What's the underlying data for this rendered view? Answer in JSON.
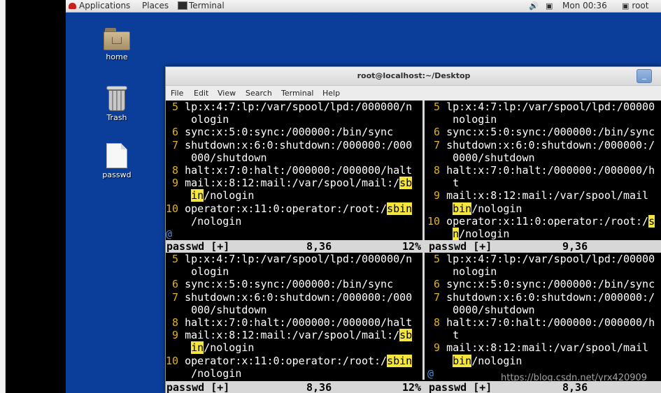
{
  "top_panel": {
    "applications_label": "Applications",
    "places_label": "Places",
    "task_label": "Terminal",
    "clock": "Mon 00:36",
    "user": "root"
  },
  "desktop_icons": [
    {
      "label": "home",
      "icon": "folder-icon"
    },
    {
      "label": "Trash",
      "icon": "trash-icon"
    },
    {
      "label": "passwd",
      "icon": "file-icon"
    }
  ],
  "window": {
    "title": "root@localhost:~/Desktop",
    "minimize_label": "_",
    "menu": [
      "File",
      "Edit",
      "View",
      "Search",
      "Terminal",
      "Help"
    ]
  },
  "panes": {
    "top_left": {
      "lines": [
        {
          "n": " 5",
          "segs": [
            {
              "t": " lp:x:4:7:lp:/var/spool/lpd:/000000/n"
            }
          ]
        },
        {
          "n": "",
          "segs": [
            {
              "t": "    ologin"
            }
          ]
        },
        {
          "n": " 6",
          "segs": [
            {
              "t": " sync:x:5:0:sync:/000000:/bin/sync"
            }
          ]
        },
        {
          "n": " 7",
          "segs": [
            {
              "t": " shutdown:x:6:0:shutdown:/000000:/000"
            }
          ]
        },
        {
          "n": "",
          "segs": [
            {
              "t": "    000/shutdown"
            }
          ]
        },
        {
          "n": " 8",
          "segs": [
            {
              "t": " halt:x:7:0:halt:/000000:/000000/halt"
            }
          ]
        },
        {
          "n": " 9",
          "segs": [
            {
              "t": " mail:x:8:12:mail:/var/spool/mail:/"
            },
            {
              "t": "sb",
              "hl": true
            }
          ]
        },
        {
          "n": "",
          "segs": [
            {
              "t": "    "
            },
            {
              "t": "in",
              "hl": true
            },
            {
              "t": "/nologin"
            }
          ]
        },
        {
          "n": "10",
          "segs": [
            {
              "t": " operator:x:11:0:operator:/root:/"
            },
            {
              "t": "sbin",
              "hl": true
            }
          ]
        },
        {
          "n": "",
          "segs": [
            {
              "t": "    /nologin"
            }
          ]
        },
        {
          "n": "",
          "segs": [
            {
              "t": "@",
              "cur": true
            }
          ]
        }
      ],
      "status": {
        "file": "passwd [+]",
        "pos": "8,36",
        "pct": "12%"
      }
    },
    "top_right": {
      "lines": [
        {
          "n": " 5",
          "segs": [
            {
              "t": " lp:x:4:7:lp:/var/spool/lpd:/00000"
            }
          ]
        },
        {
          "n": "",
          "segs": [
            {
              "t": "    nologin"
            }
          ]
        },
        {
          "n": " 6",
          "segs": [
            {
              "t": " sync:x:5:0:sync:/000000:/bin/sync"
            }
          ]
        },
        {
          "n": " 7",
          "segs": [
            {
              "t": " shutdown:x:6:0:shutdown:/000000:/"
            }
          ]
        },
        {
          "n": "",
          "segs": [
            {
              "t": "    0000/shutdown"
            }
          ]
        },
        {
          "n": " 8",
          "segs": [
            {
              "t": " halt:x:7:0:halt:/000000:/000000/h"
            }
          ]
        },
        {
          "n": "",
          "segs": [
            {
              "t": "    t"
            }
          ]
        },
        {
          "n": " 9",
          "segs": [
            {
              "t": " mail:x:8:12:mail:/var/spool/mail"
            }
          ]
        },
        {
          "n": "",
          "segs": [
            {
              "t": "    "
            },
            {
              "t": "bin",
              "hl": true
            },
            {
              "t": "/nologin"
            }
          ]
        },
        {
          "n": "10",
          "segs": [
            {
              "t": " operator:x:11:0:operator:/root:/"
            },
            {
              "t": "s",
              "hl": true
            }
          ]
        },
        {
          "n": "",
          "segs": [
            {
              "t": "    "
            },
            {
              "t": "n",
              "hl": true
            },
            {
              "t": "/nologin"
            }
          ]
        }
      ],
      "status": {
        "file": "passwd [+]",
        "pos": "9,36",
        "pct": ""
      }
    },
    "bottom_left": {
      "lines": [
        {
          "n": " 5",
          "segs": [
            {
              "t": " lp:x:4:7:lp:/var/spool/lpd:/000000/n"
            }
          ]
        },
        {
          "n": "",
          "segs": [
            {
              "t": "    ologin"
            }
          ]
        },
        {
          "n": " 6",
          "segs": [
            {
              "t": " sync:x:5:0:sync:/000000:/bin/sync"
            }
          ]
        },
        {
          "n": " 7",
          "segs": [
            {
              "t": " shutdown:x:6:0:shutdown:/000000:/000"
            }
          ]
        },
        {
          "n": "",
          "segs": [
            {
              "t": "    000/shutdown"
            }
          ]
        },
        {
          "n": " 8",
          "segs": [
            {
              "t": " halt:x:7:0:halt:/000000:/000000/halt"
            }
          ]
        },
        {
          "n": " 9",
          "segs": [
            {
              "t": " mail:x:8:12:mail:/var/spool/mail:/"
            },
            {
              "t": "sb",
              "hl": true
            }
          ]
        },
        {
          "n": "",
          "segs": [
            {
              "t": "    "
            },
            {
              "t": "in",
              "hl": true
            },
            {
              "t": "/nologin"
            }
          ]
        },
        {
          "n": "10",
          "segs": [
            {
              "t": " operator:x:11:0:operator:/root:/"
            },
            {
              "t": "sbin",
              "hl": true
            }
          ]
        },
        {
          "n": "",
          "segs": [
            {
              "t": "    /nologin"
            }
          ]
        }
      ],
      "status": {
        "file": "passwd [+]",
        "pos": "8,36",
        "pct": "12%"
      }
    },
    "bottom_right": {
      "lines": [
        {
          "n": " 5",
          "segs": [
            {
              "t": " lp:x:4:7:lp:/var/spool/lpd:/00000"
            }
          ]
        },
        {
          "n": "",
          "segs": [
            {
              "t": "    nologin"
            }
          ]
        },
        {
          "n": " 6",
          "segs": [
            {
              "t": " sync:x:5:0:sync:/000000:/bin/sync"
            }
          ]
        },
        {
          "n": " 7",
          "segs": [
            {
              "t": " shutdown:x:6:0:shutdown:/000000:/"
            }
          ]
        },
        {
          "n": "",
          "segs": [
            {
              "t": "    0000/shutdown"
            }
          ]
        },
        {
          "n": " 8",
          "segs": [
            {
              "t": " halt:x:7:0:halt:/000000:/000000/h"
            }
          ]
        },
        {
          "n": "",
          "segs": [
            {
              "t": "    t"
            }
          ]
        },
        {
          "n": " 9",
          "segs": [
            {
              "t": " mail:x:8:12:mail:/var/spool/mail"
            }
          ]
        },
        {
          "n": "",
          "segs": [
            {
              "t": "    "
            },
            {
              "t": "bin",
              "hl": true
            },
            {
              "t": "/nologin"
            }
          ]
        },
        {
          "n": "",
          "segs": [
            {
              "t": "@",
              "cur": true
            }
          ]
        }
      ],
      "status": {
        "file": "passwd [+]",
        "pos": "8,36",
        "pct": ""
      }
    }
  },
  "watermark": "https://blog.csdn.net/yrx420909",
  "colors": {
    "desktop": "#0b3e9a",
    "line_number": "#e0b21c",
    "search_highlight": "#f5e63e",
    "status_bar": "#d7d7d7"
  }
}
